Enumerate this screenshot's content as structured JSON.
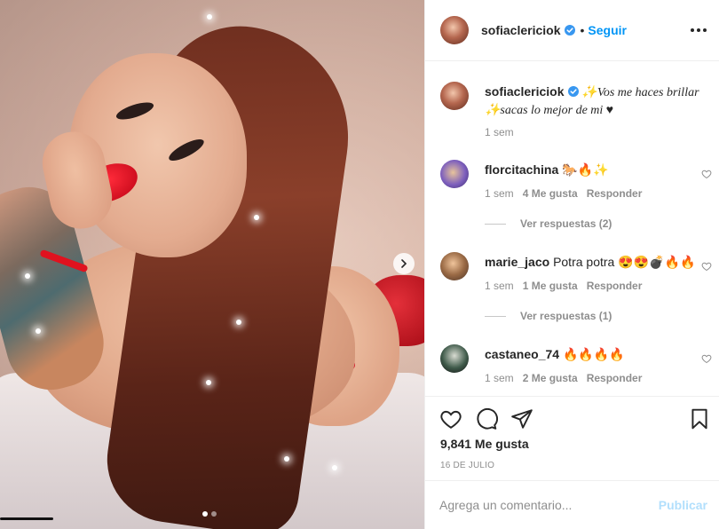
{
  "post": {
    "author": "sofiaclericiok",
    "follow_label": "Seguir",
    "dot": "•",
    "caption": "✨Vos me haces brillar ✨sacas lo mejor de mi ♥",
    "caption_time": "1 sem",
    "likes": "9,841 Me gusta",
    "date": "16 DE JULIO",
    "carousel": {
      "slides": 2,
      "active_slide": 1
    }
  },
  "comments": [
    {
      "user": "florcitachina",
      "text": "🐎🔥✨",
      "time": "1 sem",
      "likes": "4 Me gusta",
      "reply_label": "Responder",
      "view_replies": "Ver respuestas (2)"
    },
    {
      "user": "marie_jaco",
      "text": "Potra potra 😍😍💣🔥🔥",
      "time": "1 sem",
      "likes": "1 Me gusta",
      "reply_label": "Responder",
      "view_replies": "Ver respuestas (1)"
    },
    {
      "user": "castaneo_74",
      "text": "🔥🔥🔥🔥",
      "time": "1 sem",
      "likes": "2 Me gusta",
      "reply_label": "Responder"
    }
  ],
  "composer": {
    "placeholder": "Agrega un comentario...",
    "publish_label": "Publicar"
  },
  "icons": {
    "verified": "verified-badge-icon",
    "more": "more-options-icon",
    "like": "heart-icon",
    "comment": "comment-icon",
    "share": "share-icon",
    "save": "bookmark-icon",
    "next": "chevron-right-icon"
  },
  "colors": {
    "accent": "#0095f6",
    "publish_disabled": "#b2dffc",
    "muted": "#8e8e8e",
    "text": "#262626"
  }
}
